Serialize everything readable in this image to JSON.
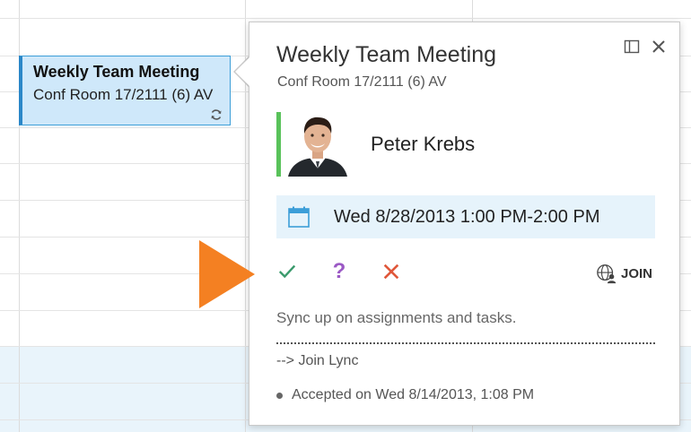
{
  "appointment": {
    "title": "Weekly Team Meeting",
    "location": "Conf Room 17/2111 (6) AV"
  },
  "card": {
    "title": "Weekly Team Meeting",
    "location": "Conf Room 17/2111 (6) AV",
    "organizer": "Peter Krebs",
    "datetime": "Wed 8/28/2013 1:00 PM-2:00 PM",
    "join_label": "JOIN",
    "description": "Sync up on assignments and tasks.",
    "lync_link": "--> Join Lync",
    "accepted_text": "Accepted on Wed 8/14/2013, 1:08 PM"
  },
  "responses": {
    "tentative_glyph": "?"
  },
  "colors": {
    "accent": "#2b87c8",
    "accept": "#3a9a6c",
    "tentative": "#9b59c5",
    "decline": "#e0573a",
    "arrow": "#f48022",
    "organizer_status": "#59c25a"
  },
  "icons": [
    "sync-icon",
    "popout-icon",
    "close-icon",
    "calendar-icon",
    "checkmark-icon",
    "question-icon",
    "decline-x-icon",
    "globe-person-icon"
  ]
}
